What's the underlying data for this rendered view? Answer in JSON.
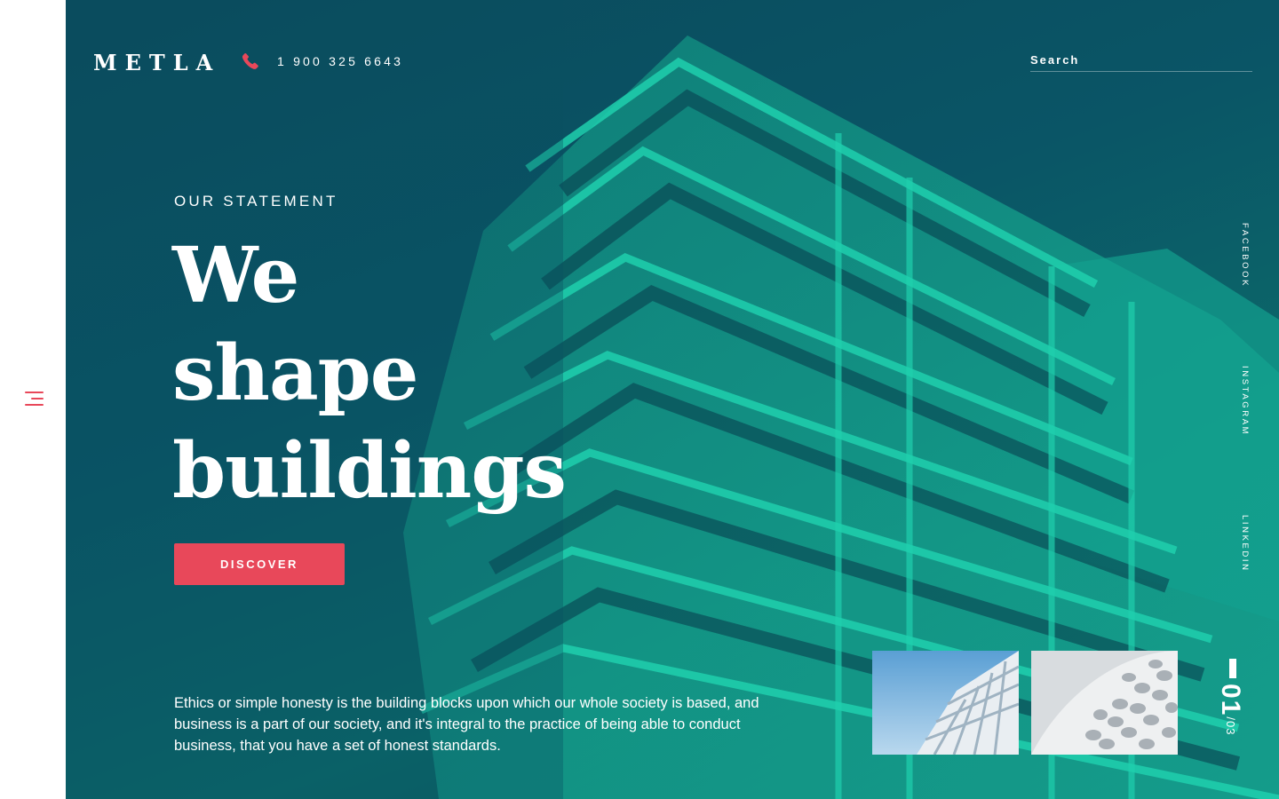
{
  "brand": {
    "logo": "METLA"
  },
  "header": {
    "phone_icon": "phone-icon",
    "phone": "1 900 325 6643",
    "search_placeholder": "Search"
  },
  "nav": {
    "menu_icon": "hamburger-menu-icon"
  },
  "hero": {
    "eyebrow": "OUR STATEMENT",
    "headline_lines": [
      "We",
      "shape",
      "buildings"
    ],
    "cta_label": "DISCOVER",
    "body": "Ethics or simple honesty is the building blocks upon which our whole society is based, and business is a part of our society, and it's integral to the practice of being able to conduct business, that you have a set of honest standards."
  },
  "social": [
    "FACEBOOK",
    "INSTAGRAM",
    "LINKEDIN"
  ],
  "slider": {
    "current": "01",
    "total": "/03",
    "thumbnails": [
      "thumbnail-white-facade",
      "thumbnail-curved-facade"
    ]
  },
  "colors": {
    "accent": "#e8485a",
    "hero_tint": "#0a5566",
    "building": "#14a892"
  }
}
